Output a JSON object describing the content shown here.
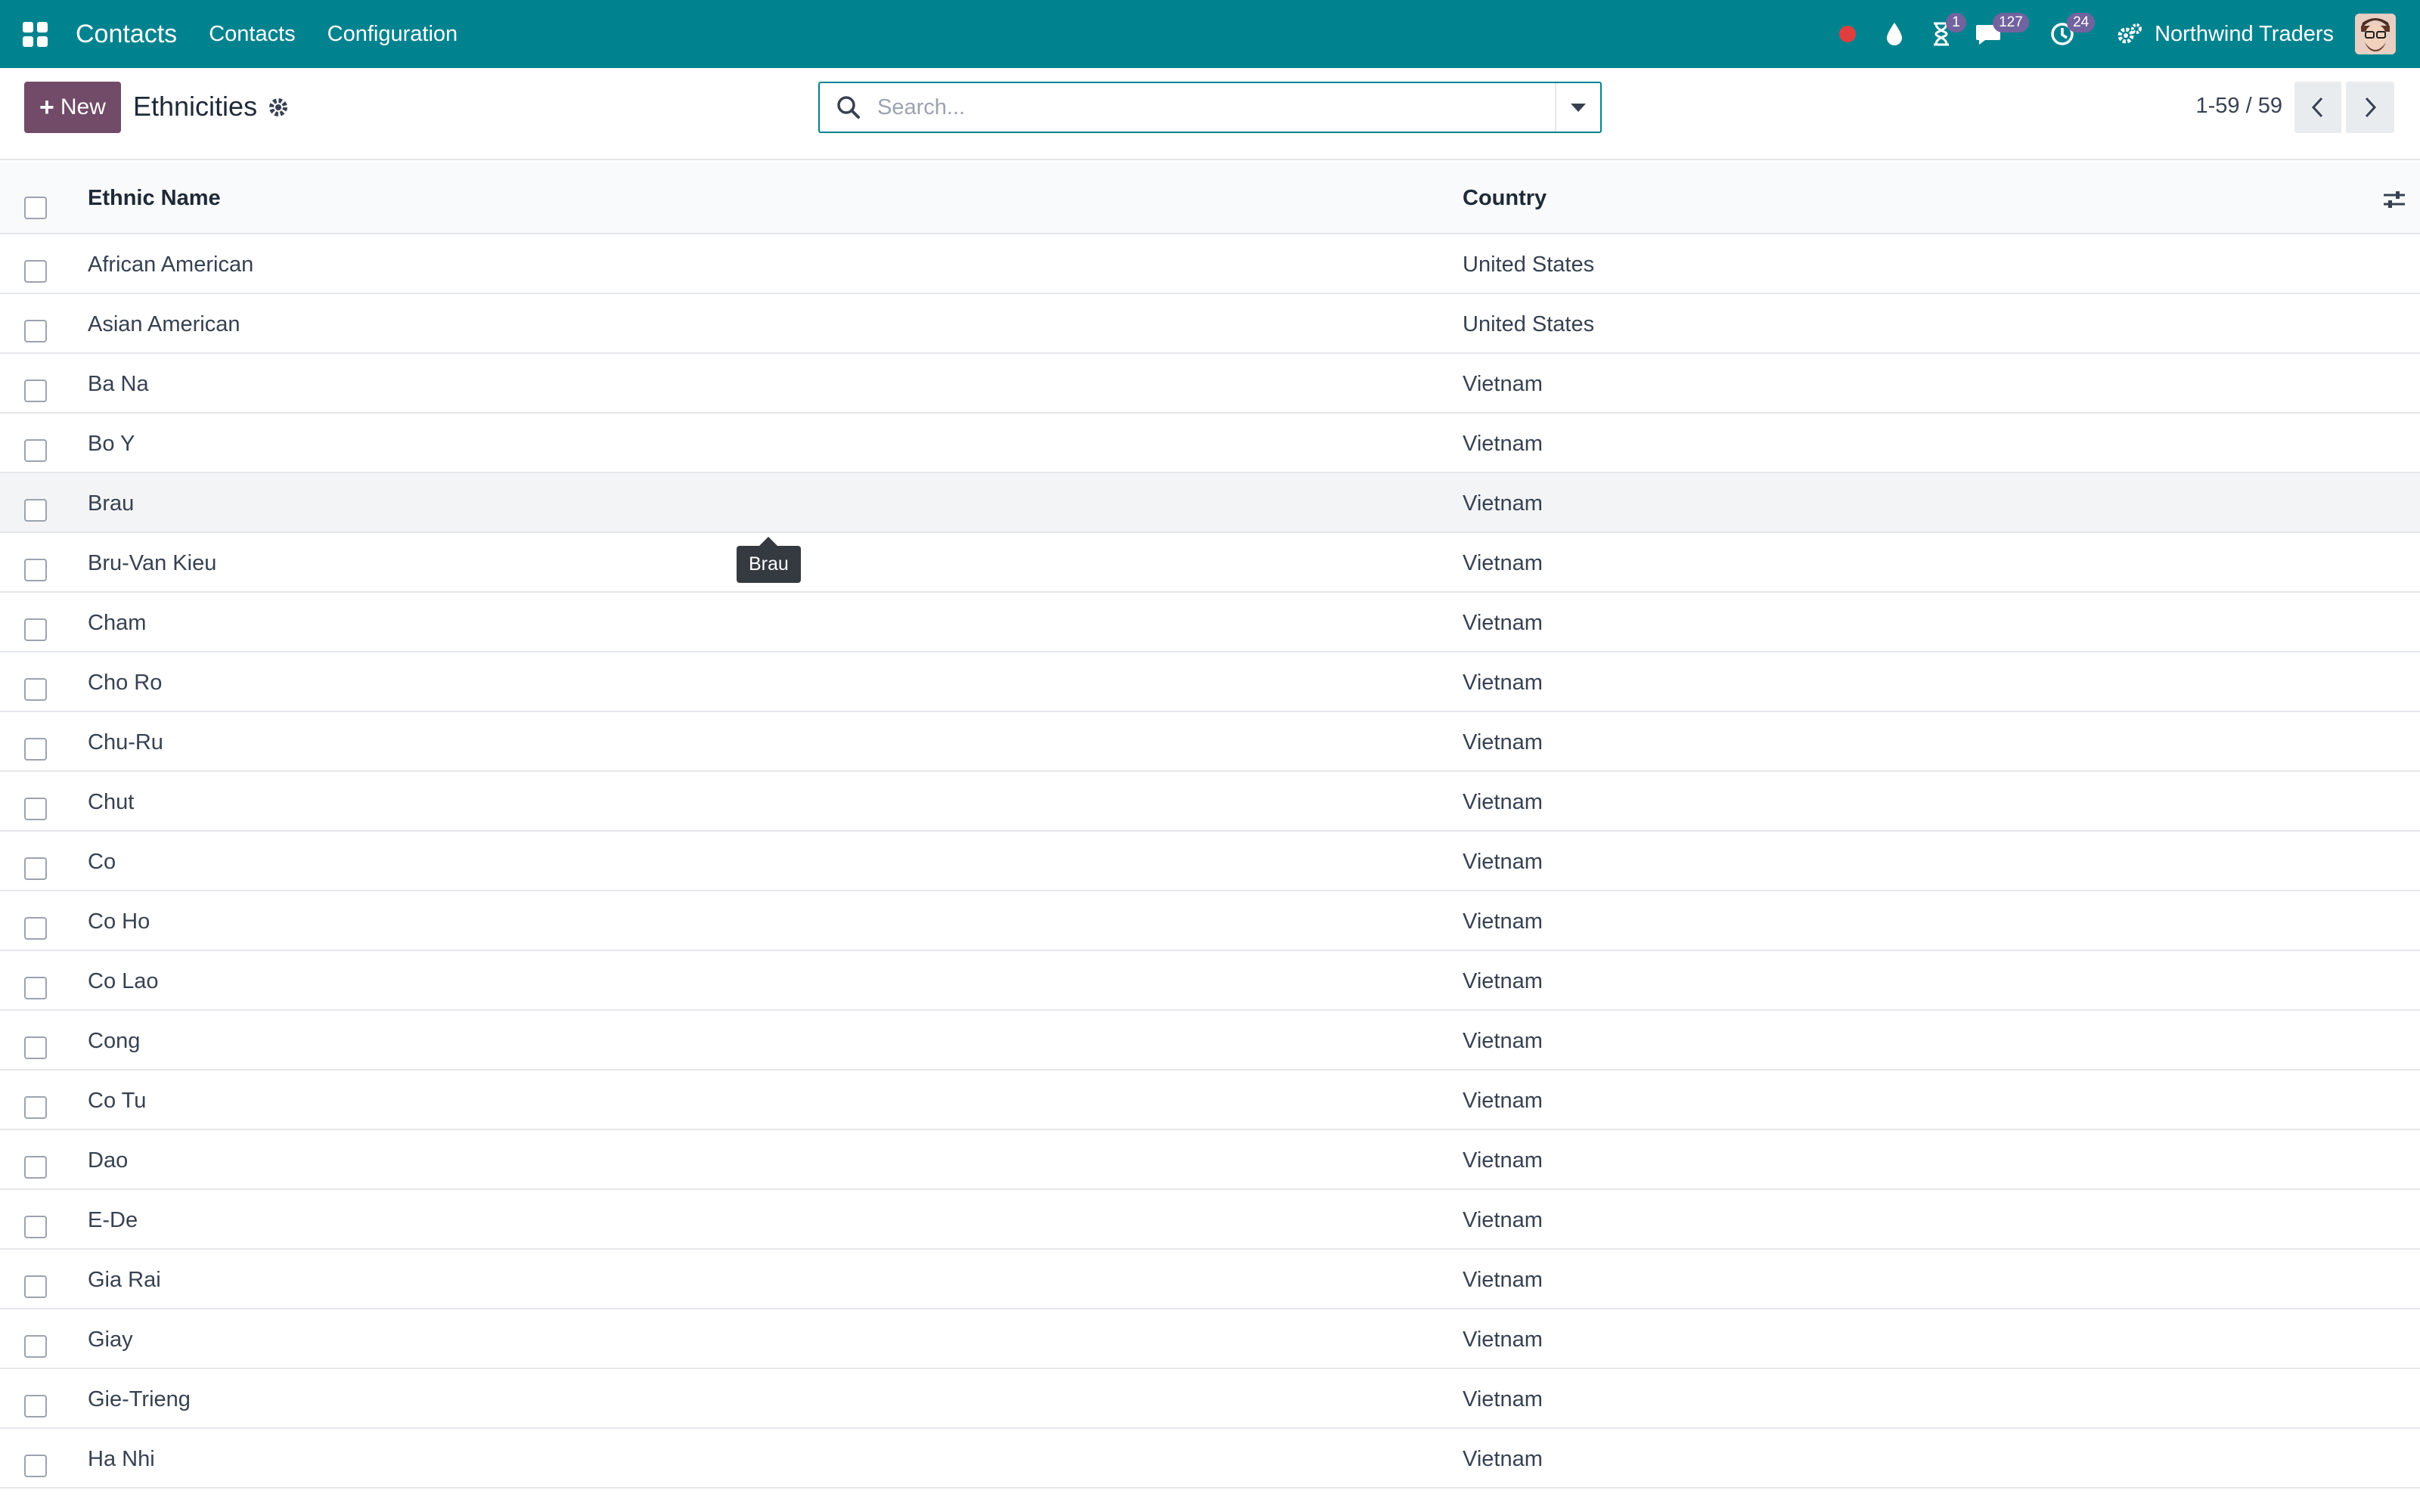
{
  "navbar": {
    "brand": "Contacts",
    "menus": [
      "Contacts",
      "Configuration"
    ],
    "badges": {
      "activity": "1",
      "messages": "127",
      "clock": "24"
    },
    "company": "Northwind Traders",
    "colors": {
      "bar": "#01838f",
      "badge": "#71639e",
      "record": "#e03e3e"
    }
  },
  "control_panel": {
    "new_label": "New",
    "title": "Ethnicities",
    "search_placeholder": "Search...",
    "pager": "1-59 / 59"
  },
  "table": {
    "headers": {
      "name": "Ethnic Name",
      "country": "Country"
    },
    "rows": [
      {
        "name": "African American",
        "country": "United States"
      },
      {
        "name": "Asian American",
        "country": "United States"
      },
      {
        "name": "Ba Na",
        "country": "Vietnam"
      },
      {
        "name": "Bo Y",
        "country": "Vietnam"
      },
      {
        "name": "Brau",
        "country": "Vietnam"
      },
      {
        "name": "Bru-Van Kieu",
        "country": "Vietnam"
      },
      {
        "name": "Cham",
        "country": "Vietnam"
      },
      {
        "name": "Cho Ro",
        "country": "Vietnam"
      },
      {
        "name": "Chu-Ru",
        "country": "Vietnam"
      },
      {
        "name": "Chut",
        "country": "Vietnam"
      },
      {
        "name": "Co",
        "country": "Vietnam"
      },
      {
        "name": "Co Ho",
        "country": "Vietnam"
      },
      {
        "name": "Co Lao",
        "country": "Vietnam"
      },
      {
        "name": "Cong",
        "country": "Vietnam"
      },
      {
        "name": "Co Tu",
        "country": "Vietnam"
      },
      {
        "name": "Dao",
        "country": "Vietnam"
      },
      {
        "name": "E-De",
        "country": "Vietnam"
      },
      {
        "name": "Gia Rai",
        "country": "Vietnam"
      },
      {
        "name": "Giay",
        "country": "Vietnam"
      },
      {
        "name": "Gie-Trieng",
        "country": "Vietnam"
      },
      {
        "name": "Ha Nhi",
        "country": "Vietnam"
      }
    ]
  },
  "tooltip": {
    "text": "Brau"
  }
}
